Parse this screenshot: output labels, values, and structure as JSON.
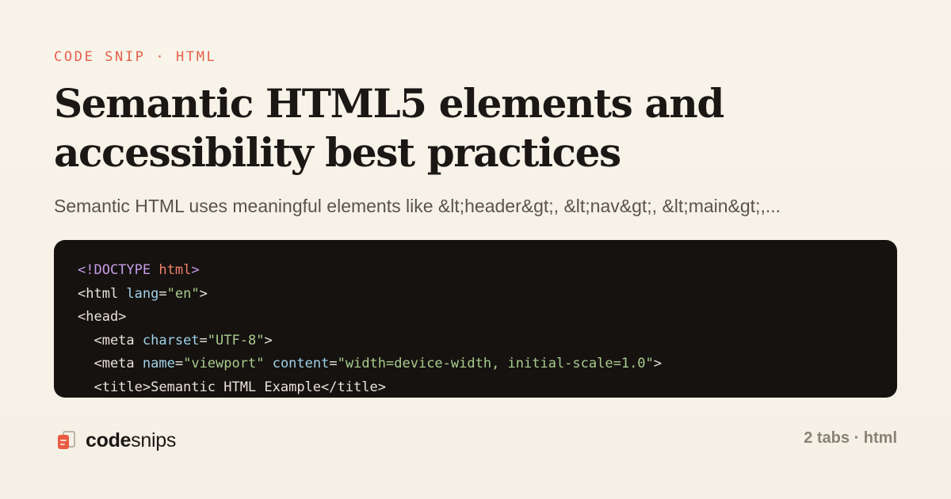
{
  "header": {
    "eyebrow": "CODE SNIP · HTML",
    "title": "Semantic HTML5 elements and accessibility best practices",
    "description": "Semantic HTML uses meaningful elements like &lt;header&gt;, &lt;nav&gt;, &lt;main&gt;,..."
  },
  "code": {
    "lines": [
      [
        {
          "t": "<!DOCTYPE ",
          "c": "kw"
        },
        {
          "t": "html",
          "c": "tag"
        },
        {
          "t": ">",
          "c": "kw"
        }
      ],
      [
        {
          "t": "<html ",
          "c": "txt"
        },
        {
          "t": "lang",
          "c": "attr"
        },
        {
          "t": "=",
          "c": "txt"
        },
        {
          "t": "\"en\"",
          "c": "str"
        },
        {
          "t": ">",
          "c": "txt"
        }
      ],
      [
        {
          "t": "<head>",
          "c": "txt"
        }
      ],
      [
        {
          "t": "  <meta ",
          "c": "txt"
        },
        {
          "t": "charset",
          "c": "attr"
        },
        {
          "t": "=",
          "c": "txt"
        },
        {
          "t": "\"UTF-8\"",
          "c": "str"
        },
        {
          "t": ">",
          "c": "txt"
        }
      ],
      [
        {
          "t": "  <meta ",
          "c": "txt"
        },
        {
          "t": "name",
          "c": "attr"
        },
        {
          "t": "=",
          "c": "txt"
        },
        {
          "t": "\"viewport\"",
          "c": "str"
        },
        {
          "t": " ",
          "c": "txt"
        },
        {
          "t": "content",
          "c": "attr"
        },
        {
          "t": "=",
          "c": "txt"
        },
        {
          "t": "\"width=device-width, initial-scale=1.0\"",
          "c": "str"
        },
        {
          "t": ">",
          "c": "txt"
        }
      ],
      [
        {
          "t": "  <title>Semantic HTML Example</title>",
          "c": "txt"
        }
      ]
    ]
  },
  "footer": {
    "brand_bold": "code",
    "brand_rest": "snips",
    "meta": "2 tabs · html"
  },
  "colors": {
    "accent": "#e8604a",
    "background": "#f5f0e6",
    "code_background": "#151210",
    "token_keyword": "#c79ce6",
    "token_tag": "#f0826a",
    "token_attribute": "#9fd1e8",
    "token_string": "#a9cc8c"
  },
  "icons": {
    "logo": "code-snippet-cards-icon"
  }
}
